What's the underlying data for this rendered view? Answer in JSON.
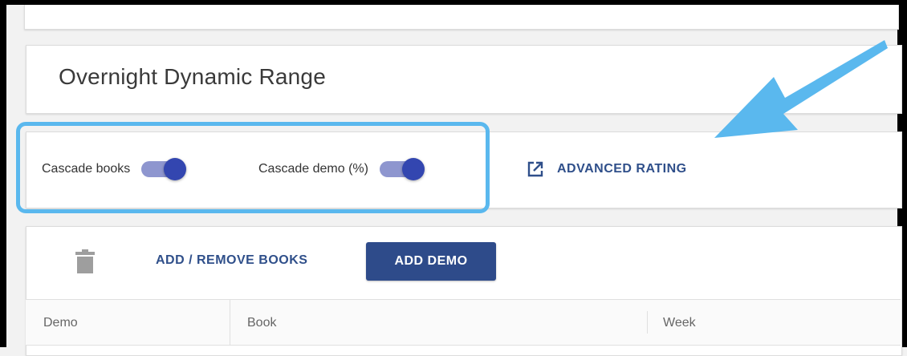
{
  "title_card": {
    "title": "Overnight Dynamic Range"
  },
  "options": {
    "cascade_books": {
      "label": "Cascade books",
      "on": true
    },
    "cascade_demo": {
      "label": "Cascade demo (%)",
      "on": true
    },
    "advanced_rating": {
      "label": "ADVANCED RATING",
      "icon": "open-in-new-icon"
    }
  },
  "toolbar": {
    "delete_icon": "trash-icon",
    "add_remove_books": "ADD / REMOVE BOOKS",
    "add_demo": "ADD DEMO"
  },
  "table": {
    "columns": [
      "Demo",
      "Book",
      "Week"
    ]
  },
  "annotations": {
    "highlight_color": "#5ab8ee",
    "arrow_color": "#5ab8ee"
  },
  "colors": {
    "accent": "#2e4b8a",
    "switch_thumb": "#3346b0",
    "switch_track": "#8e96cf"
  }
}
